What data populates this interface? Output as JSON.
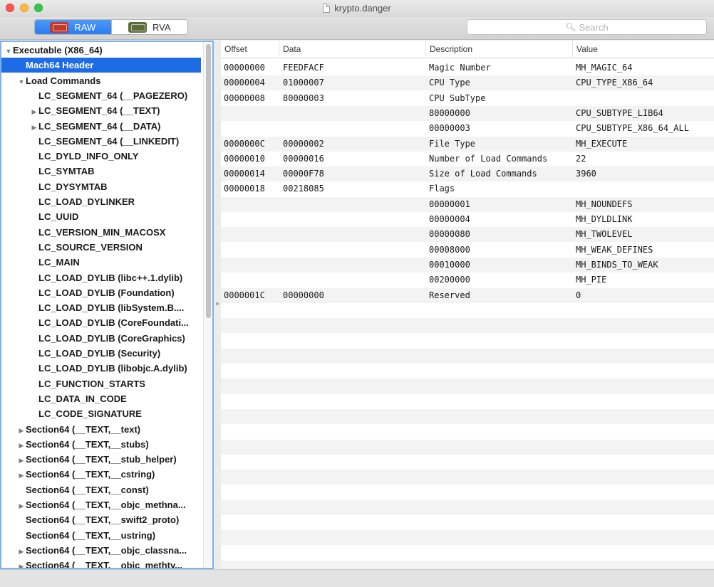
{
  "window": {
    "title": "krypto.danger"
  },
  "toolbar": {
    "segments": [
      {
        "label": "RAW",
        "icon": "raw-chip-icon",
        "active": true
      },
      {
        "label": "RVA",
        "icon": "rva-chip-icon",
        "active": false
      }
    ],
    "search_placeholder": "Search"
  },
  "sidebar": {
    "items": [
      {
        "label": "Executable  (X86_64)",
        "depth": 0,
        "disclosure": "expanded"
      },
      {
        "label": "Mach64 Header",
        "depth": 1,
        "disclosure": "none",
        "selected": true
      },
      {
        "label": "Load Commands",
        "depth": 1,
        "disclosure": "expanded"
      },
      {
        "label": "LC_SEGMENT_64 (__PAGEZERO)",
        "depth": 2,
        "disclosure": "none"
      },
      {
        "label": "LC_SEGMENT_64 (__TEXT)",
        "depth": 2,
        "disclosure": "collapsed"
      },
      {
        "label": "LC_SEGMENT_64 (__DATA)",
        "depth": 2,
        "disclosure": "collapsed"
      },
      {
        "label": "LC_SEGMENT_64 (__LINKEDIT)",
        "depth": 2,
        "disclosure": "none"
      },
      {
        "label": "LC_DYLD_INFO_ONLY",
        "depth": 2,
        "disclosure": "none"
      },
      {
        "label": "LC_SYMTAB",
        "depth": 2,
        "disclosure": "none"
      },
      {
        "label": "LC_DYSYMTAB",
        "depth": 2,
        "disclosure": "none"
      },
      {
        "label": "LC_LOAD_DYLINKER",
        "depth": 2,
        "disclosure": "none"
      },
      {
        "label": "LC_UUID",
        "depth": 2,
        "disclosure": "none"
      },
      {
        "label": "LC_VERSION_MIN_MACOSX",
        "depth": 2,
        "disclosure": "none"
      },
      {
        "label": "LC_SOURCE_VERSION",
        "depth": 2,
        "disclosure": "none"
      },
      {
        "label": "LC_MAIN",
        "depth": 2,
        "disclosure": "none"
      },
      {
        "label": "LC_LOAD_DYLIB (libc++.1.dylib)",
        "depth": 2,
        "disclosure": "none"
      },
      {
        "label": "LC_LOAD_DYLIB (Foundation)",
        "depth": 2,
        "disclosure": "none"
      },
      {
        "label": "LC_LOAD_DYLIB (libSystem.B....",
        "depth": 2,
        "disclosure": "none"
      },
      {
        "label": "LC_LOAD_DYLIB (CoreFoundati...",
        "depth": 2,
        "disclosure": "none"
      },
      {
        "label": "LC_LOAD_DYLIB (CoreGraphics)",
        "depth": 2,
        "disclosure": "none"
      },
      {
        "label": "LC_LOAD_DYLIB (Security)",
        "depth": 2,
        "disclosure": "none"
      },
      {
        "label": "LC_LOAD_DYLIB (libobjc.A.dylib)",
        "depth": 2,
        "disclosure": "none"
      },
      {
        "label": "LC_FUNCTION_STARTS",
        "depth": 2,
        "disclosure": "none"
      },
      {
        "label": "LC_DATA_IN_CODE",
        "depth": 2,
        "disclosure": "none"
      },
      {
        "label": "LC_CODE_SIGNATURE",
        "depth": 2,
        "disclosure": "none"
      },
      {
        "label": "Section64 (__TEXT,__text)",
        "depth": 1,
        "disclosure": "collapsed"
      },
      {
        "label": "Section64 (__TEXT,__stubs)",
        "depth": 1,
        "disclosure": "collapsed"
      },
      {
        "label": "Section64 (__TEXT,__stub_helper)",
        "depth": 1,
        "disclosure": "collapsed"
      },
      {
        "label": "Section64 (__TEXT,__cstring)",
        "depth": 1,
        "disclosure": "collapsed"
      },
      {
        "label": "Section64 (__TEXT,__const)",
        "depth": 1,
        "disclosure": "none"
      },
      {
        "label": "Section64 (__TEXT,__objc_methna...",
        "depth": 1,
        "disclosure": "collapsed"
      },
      {
        "label": "Section64 (__TEXT,__swift2_proto)",
        "depth": 1,
        "disclosure": "none"
      },
      {
        "label": "Section64 (__TEXT,__ustring)",
        "depth": 1,
        "disclosure": "none"
      },
      {
        "label": "Section64 (__TEXT,__objc_classna...",
        "depth": 1,
        "disclosure": "collapsed"
      },
      {
        "label": "Section64 (__TEXT,__objc_methtv...",
        "depth": 1,
        "disclosure": "collapsed"
      }
    ]
  },
  "table": {
    "columns": [
      "Offset",
      "Data",
      "Description",
      "Value"
    ],
    "rows": [
      {
        "offset": "00000000",
        "data": "FEEDFACF",
        "description": "Magic Number",
        "value": "MH_MAGIC_64"
      },
      {
        "offset": "00000004",
        "data": "01000007",
        "description": "CPU Type",
        "value": "CPU_TYPE_X86_64"
      },
      {
        "offset": "00000008",
        "data": "80000003",
        "description": "CPU SubType",
        "value": ""
      },
      {
        "offset": "",
        "data": "",
        "description": "80000000",
        "value": "CPU_SUBTYPE_LIB64"
      },
      {
        "offset": "",
        "data": "",
        "description": "00000003",
        "value": "CPU_SUBTYPE_X86_64_ALL"
      },
      {
        "offset": "0000000C",
        "data": "00000002",
        "description": "File Type",
        "value": "MH_EXECUTE"
      },
      {
        "offset": "00000010",
        "data": "00000016",
        "description": "Number of Load Commands",
        "value": "22"
      },
      {
        "offset": "00000014",
        "data": "00000F78",
        "description": "Size of Load Commands",
        "value": "3960"
      },
      {
        "offset": "00000018",
        "data": "00218085",
        "description": "Flags",
        "value": ""
      },
      {
        "offset": "",
        "data": "",
        "description": "00000001",
        "value": "MH_NOUNDEFS"
      },
      {
        "offset": "",
        "data": "",
        "description": "00000004",
        "value": "MH_DYLDLINK"
      },
      {
        "offset": "",
        "data": "",
        "description": "00000080",
        "value": "MH_TWOLEVEL"
      },
      {
        "offset": "",
        "data": "",
        "description": "00008000",
        "value": "MH_WEAK_DEFINES"
      },
      {
        "offset": "",
        "data": "",
        "description": "00010000",
        "value": "MH_BINDS_TO_WEAK"
      },
      {
        "offset": "",
        "data": "",
        "description": "00200000",
        "value": "MH_PIE"
      },
      {
        "offset": "0000001C",
        "data": "00000000",
        "description": "Reserved",
        "value": "0"
      }
    ],
    "filler_rows": 19
  },
  "colors": {
    "selection": "#1e6be6",
    "segment_active": "#2a7ef2",
    "sidebar_focus_ring": "#7fb2ea",
    "stripe": "#f3f3f3"
  }
}
